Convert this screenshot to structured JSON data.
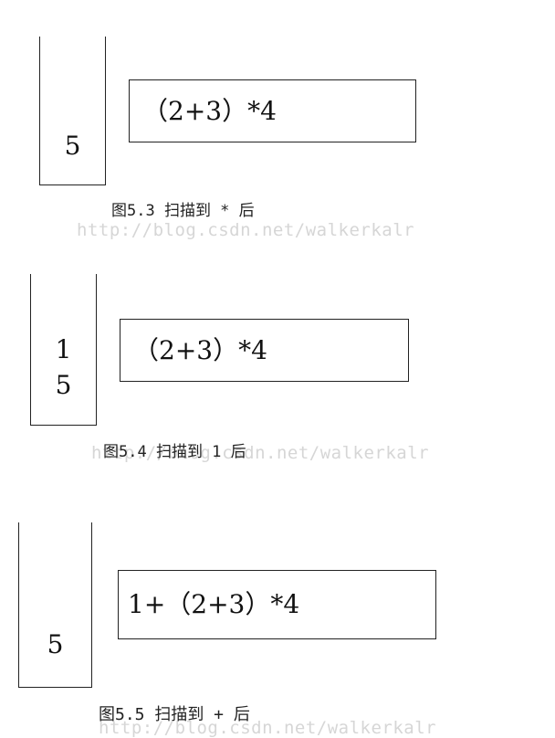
{
  "watermark": "http://blog.csdn.net/walkerkalr",
  "figures": [
    {
      "stack": [
        "5"
      ],
      "expression": "（2+3）*4",
      "caption": "图5.3 扫描到 * 后"
    },
    {
      "stack": [
        "1",
        "5"
      ],
      "expression": "（2+3）*4",
      "caption": "图5.4 扫描到 1 后"
    },
    {
      "stack": [
        "5"
      ],
      "expression": "1+（2+3）*4",
      "caption": "图5.5 扫描到 + 后"
    }
  ]
}
